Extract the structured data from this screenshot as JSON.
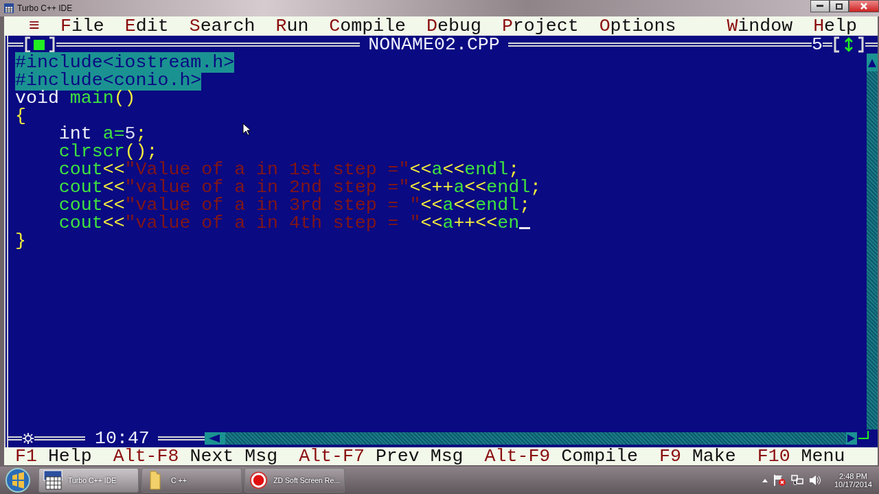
{
  "window": {
    "title": "Turbo C++ IDE"
  },
  "menu": {
    "left": [
      {
        "label": "≡"
      },
      {
        "label": "File"
      },
      {
        "label": "Edit"
      },
      {
        "label": "Search"
      },
      {
        "label": "Run"
      },
      {
        "label": "Compile"
      },
      {
        "label": "Debug"
      },
      {
        "label": "Project"
      },
      {
        "label": "Options"
      }
    ],
    "right": [
      {
        "label": "Window"
      },
      {
        "label": "Help"
      }
    ]
  },
  "editor": {
    "title": "NONAME02.CPP",
    "number": "5",
    "position": "10:47",
    "modified": true,
    "lines": [
      {
        "selected": true,
        "cursor": false,
        "tokens": [
          {
            "text": "#include<iostream.h>",
            "kind": "preprocessor"
          }
        ]
      },
      {
        "selected": true,
        "cursor": false,
        "tokens": [
          {
            "text": "#include<conio.h>",
            "kind": "preprocessor"
          }
        ]
      },
      {
        "selected": false,
        "cursor": false,
        "tokens": [
          {
            "text": "void ",
            "kind": "keyword"
          },
          {
            "text": "main",
            "kind": "identifier"
          },
          {
            "text": "()",
            "kind": "symbol"
          }
        ]
      },
      {
        "selected": false,
        "cursor": false,
        "tokens": [
          {
            "text": "{",
            "kind": "symbol"
          }
        ]
      },
      {
        "selected": false,
        "cursor": false,
        "tokens": [
          {
            "text": "    int ",
            "kind": "keyword"
          },
          {
            "text": "a=",
            "kind": "identifier"
          },
          {
            "text": "5",
            "kind": "number"
          },
          {
            "text": ";",
            "kind": "symbol"
          }
        ]
      },
      {
        "selected": false,
        "cursor": false,
        "tokens": [
          {
            "text": "    clrscr",
            "kind": "identifier"
          },
          {
            "text": "();",
            "kind": "symbol"
          }
        ]
      },
      {
        "selected": false,
        "cursor": false,
        "tokens": [
          {
            "text": "    cout",
            "kind": "identifier"
          },
          {
            "text": "<<",
            "kind": "symbol"
          },
          {
            "text": "\"Value of a in 1st step =\"",
            "kind": "string"
          },
          {
            "text": "<<",
            "kind": "symbol"
          },
          {
            "text": "a",
            "kind": "identifier"
          },
          {
            "text": "<<",
            "kind": "symbol"
          },
          {
            "text": "endl",
            "kind": "identifier"
          },
          {
            "text": ";",
            "kind": "symbol"
          }
        ]
      },
      {
        "selected": false,
        "cursor": false,
        "tokens": [
          {
            "text": "    cout",
            "kind": "identifier"
          },
          {
            "text": "<<",
            "kind": "symbol"
          },
          {
            "text": "\"value of a in 2nd step =\"",
            "kind": "string"
          },
          {
            "text": "<<++",
            "kind": "symbol"
          },
          {
            "text": "a",
            "kind": "identifier"
          },
          {
            "text": "<<",
            "kind": "symbol"
          },
          {
            "text": "endl",
            "kind": "identifier"
          },
          {
            "text": ";",
            "kind": "symbol"
          }
        ]
      },
      {
        "selected": false,
        "cursor": false,
        "tokens": [
          {
            "text": "    cout",
            "kind": "identifier"
          },
          {
            "text": "<<",
            "kind": "symbol"
          },
          {
            "text": "\"value of a in 3rd step = \"",
            "kind": "string"
          },
          {
            "text": "<<",
            "kind": "symbol"
          },
          {
            "text": "a",
            "kind": "identifier"
          },
          {
            "text": "<<",
            "kind": "symbol"
          },
          {
            "text": "endl",
            "kind": "identifier"
          },
          {
            "text": ";",
            "kind": "symbol"
          }
        ]
      },
      {
        "selected": false,
        "cursor": true,
        "tokens": [
          {
            "text": "    cout",
            "kind": "identifier"
          },
          {
            "text": "<<",
            "kind": "symbol"
          },
          {
            "text": "\"value of a in 4th step = \"",
            "kind": "string"
          },
          {
            "text": "<<",
            "kind": "symbol"
          },
          {
            "text": "a",
            "kind": "identifier"
          },
          {
            "text": "++<<",
            "kind": "symbol"
          },
          {
            "text": "en",
            "kind": "identifier"
          }
        ]
      },
      {
        "selected": false,
        "cursor": false,
        "tokens": [
          {
            "text": "}",
            "kind": "symbol"
          }
        ]
      }
    ]
  },
  "function_keys": [
    {
      "key": "F1",
      "label": "Help"
    },
    {
      "key": "Alt-F8",
      "label": "Next Msg"
    },
    {
      "key": "Alt-F7",
      "label": "Prev Msg"
    },
    {
      "key": "Alt-F9",
      "label": "Compile"
    },
    {
      "key": "F9",
      "label": "Make"
    },
    {
      "key": "F10",
      "label": "Menu"
    }
  ],
  "taskbar": {
    "buttons": [
      {
        "label": "Turbo C++ IDE",
        "kind": "app",
        "selected": true
      },
      {
        "label": "C ++",
        "kind": "folder",
        "selected": false
      },
      {
        "label": "ZD Soft Screen Re...",
        "kind": "record",
        "selected": false
      }
    ],
    "time": "2:48 PM",
    "date": "10/17/2014"
  }
}
